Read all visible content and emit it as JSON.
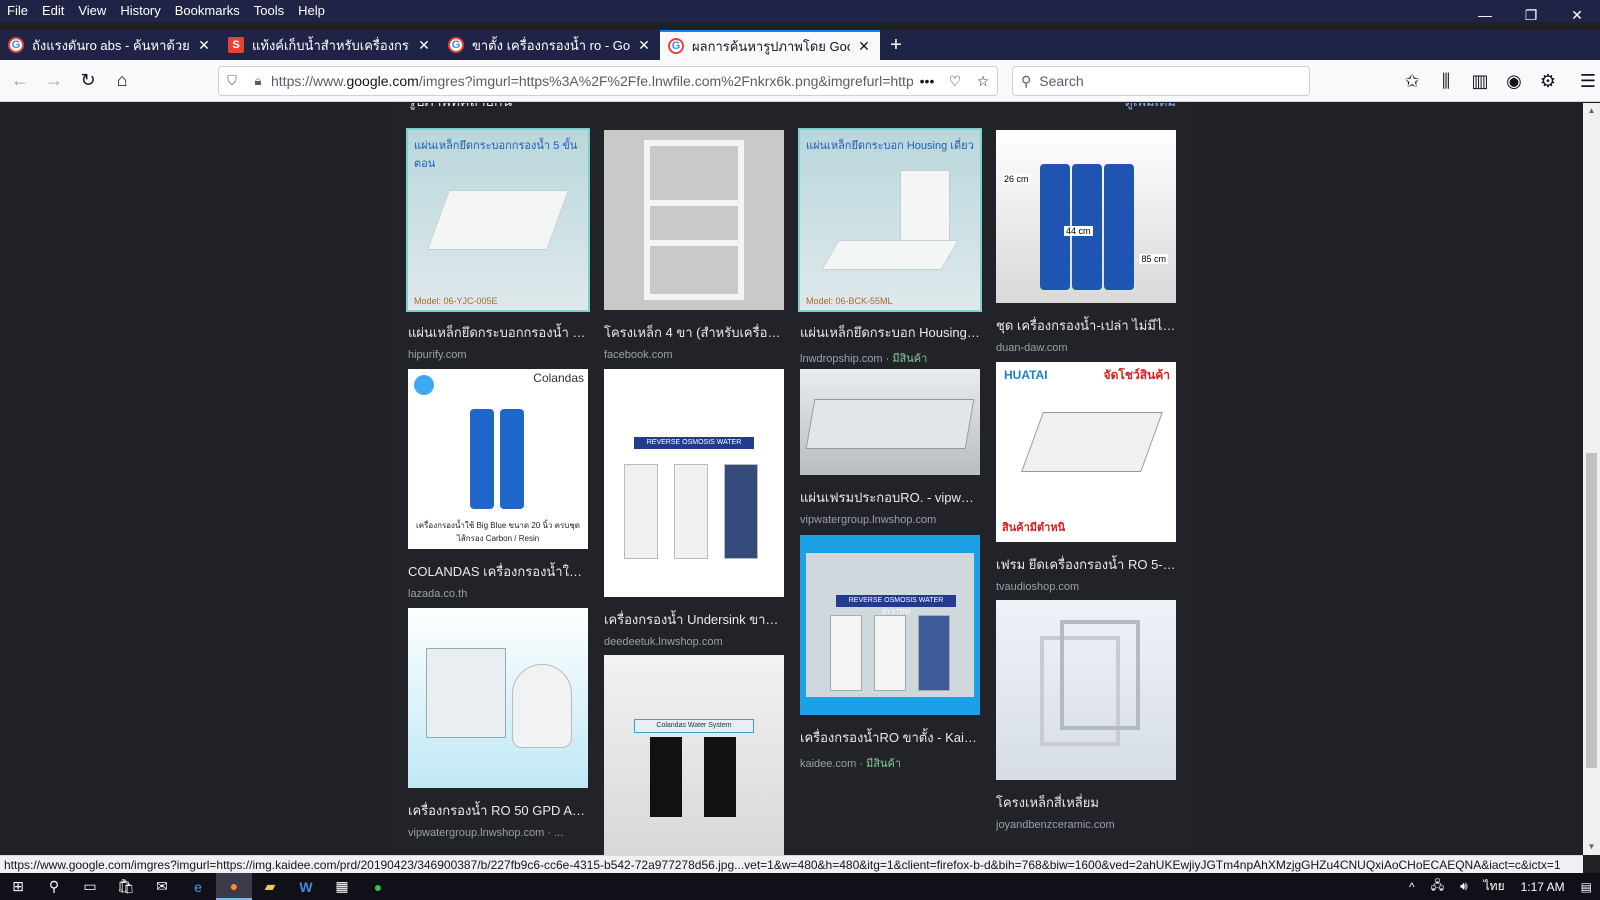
{
  "menu": [
    "File",
    "Edit",
    "View",
    "History",
    "Bookmarks",
    "Tools",
    "Help"
  ],
  "window_controls": {
    "minimize": "—",
    "restore": "❐",
    "close": "✕"
  },
  "tabs": [
    {
      "title": "ถังแรงดันro abs - ค้นหาด้วย Goo",
      "favicon": "google"
    },
    {
      "title": "แท้งค์เก็บน้ำสำหรับเครื่องกรองน้ำ",
      "favicon": "shop"
    },
    {
      "title": "ขาตั้ง เครื่องกรองน้ำ ro - Google",
      "favicon": "google"
    },
    {
      "title": "ผลการค้นหารูปภาพโดย Google",
      "favicon": "google",
      "active": true
    }
  ],
  "url": {
    "prefix": "https://www.",
    "domain": "google.com",
    "rest": "/imgres?imgurl=https%3A%2F%2Ffe.lnwfile.com%2Fnkrx6k.png&imgrefurl=http"
  },
  "search_placeholder": "Search",
  "section": {
    "title": "รูปภาพที่คล้ายกัน",
    "more": "ดูเพิ่มเติม"
  },
  "results": [
    {
      "title": "แผ่นเหล็กยึดกระบอกกรองน้ำ 5 ...",
      "source": "hipurify.com",
      "stock": "",
      "caption": "แผ่นเหล็กยึดกระบอกกรองน้ำ 5 ขั้นตอน",
      "tag": "Model: 06-YJC-005E"
    },
    {
      "title": "โครงเหล็ก 4 ขา (สำหรับเครื่องก...",
      "source": "facebook.com",
      "stock": ""
    },
    {
      "title": "แผ่นเหล็กยึดกระบอก Housing ...",
      "source": "lnwdropship.com",
      "stock": " · มีสินค้า",
      "caption": "แผ่นเหล็กยึดกระบอก Housing เดี่ยว",
      "tag": "Model: 06-BCK-55ML"
    },
    {
      "title": "ชุด เครื่องกรองน้ำ-เปล่า ไม่มีไส้...",
      "source": "duan-daw.com",
      "stock": "",
      "dims": [
        "26 cm",
        "44 cm",
        "85 cm"
      ]
    },
    {
      "title": "COLANDAS เครื่องกรองน้ำใช้ ...",
      "source": "lazada.co.th",
      "stock": "",
      "brand": "Colandas",
      "caption": "เครื่องกรองน้ำใช้ Big Blue ขนาด 20 นิ้ว ครบชุด ไส้กรอง Carbon / Resin"
    },
    {
      "title": "เครื่องกรองน้ำ Undersink ขาตั้...",
      "source": "deedeetuk.lnwshop.com",
      "stock": "",
      "label": "REVERSE OSMOSIS WATER SYSTEM"
    },
    {
      "title": "แผ่นเฟรมประกอบRO. - vipwat...",
      "source": "vipwatergroup.lnwshop.com",
      "stock": ""
    },
    {
      "title": "เฟรม ยึดเครื่องกรองน้ำ RO 5-6 ...",
      "source": "tvaudioshop.com",
      "stock": "",
      "brand": "HUATAI",
      "caption": "จัดโชว์สินค้า",
      "footer": "สินค้ามีตำหนิ"
    },
    {
      "title": "เครื่องกรองน้ำ RO 50 GPD AQ...",
      "source": "vipwatergroup.lnwshop.com · ...",
      "stock": ""
    },
    {
      "title": "",
      "source": "",
      "stock": "",
      "label": "Colandas Water System"
    },
    {
      "title": "เครื่องกรองน้ำRO ขาตั้ง - Kaidee",
      "source": "kaidee.com",
      "stock": " · มีสินค้า",
      "label": "REVERSE OSMOSIS WATER SYSTEM"
    },
    {
      "title": "โครงเหล็กสี่เหลี่ยม",
      "source": "joyandbenzceramic.com",
      "stock": ""
    }
  ],
  "status_url": "https://www.google.com/imgres?imgurl=https://img.kaidee.com/prd/20190423/346900387/b/227fb9c6-cc6e-4315-b542-72a977278d56.jpg...vet=1&w=480&h=480&itg=1&client=firefox-b-d&bih=768&biw=1600&ved=2ahUKEwjiyJGTm4npAhXMzjgGHZu4CNUQxiAoCHoECAEQNA&iact=c&ictx=1",
  "taskbar": {
    "lang": "ไทย",
    "time": "1:17 AM"
  }
}
